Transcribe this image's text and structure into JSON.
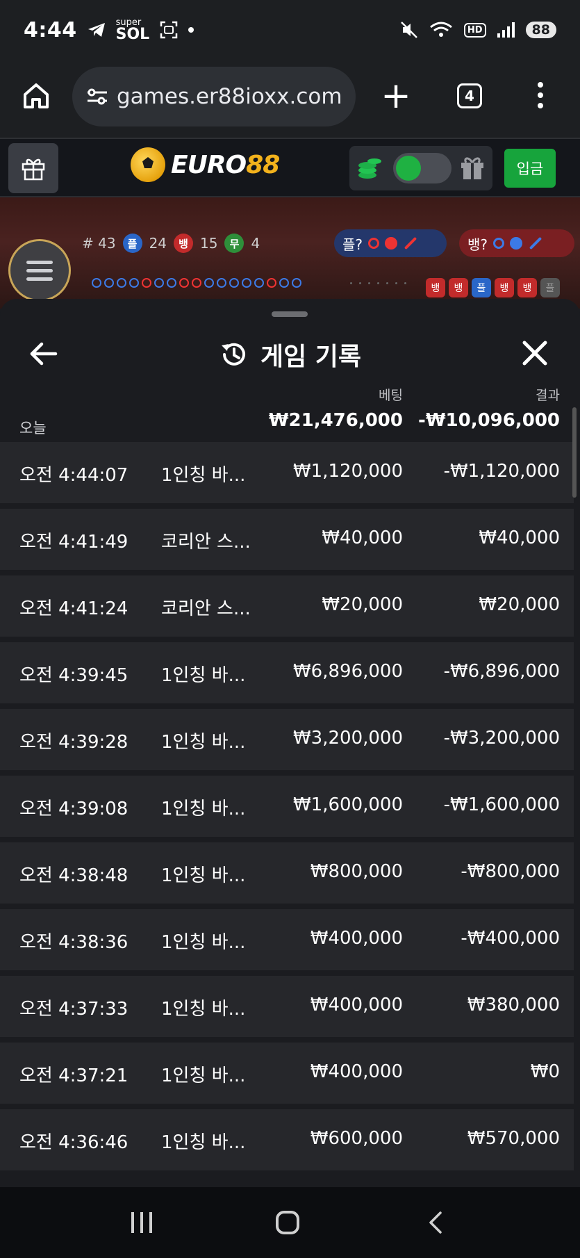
{
  "status_bar": {
    "time": "4:44",
    "super_line1": "super",
    "super_line2": "SOL",
    "hd": "HD",
    "battery": "88"
  },
  "browser": {
    "url": "games.er88ioxx.com",
    "tab_count": "4"
  },
  "site": {
    "logo_text_a": "EURO",
    "logo_text_b": "88",
    "deposit_label": "입금",
    "toggle_on": true
  },
  "game": {
    "round": "# 43",
    "player_label": "플",
    "player_count": "24",
    "banker_label": "뱅",
    "banker_count": "15",
    "tie_label": "무",
    "tie_count": "4",
    "ask_player": "플?",
    "ask_banker": "뱅?",
    "history_tags": [
      "뱅",
      "뱅",
      "플",
      "뱅",
      "뱅",
      "플"
    ]
  },
  "sheet": {
    "title": "게임 기록",
    "col_bet": "베팅",
    "col_result": "결과",
    "today_label": "오늘",
    "total_bet": "₩21,476,000",
    "total_result": "-₩10,096,000",
    "rows": [
      {
        "time": "오전 4:44:07",
        "game": "1인칭 바...",
        "bet": "₩1,120,000",
        "result": "-₩1,120,000"
      },
      {
        "time": "오전 4:41:49",
        "game": "코리안 스...",
        "bet": "₩40,000",
        "result": "₩40,000"
      },
      {
        "time": "오전 4:41:24",
        "game": "코리안 스...",
        "bet": "₩20,000",
        "result": "₩20,000"
      },
      {
        "time": "오전 4:39:45",
        "game": "1인칭 바...",
        "bet": "₩6,896,000",
        "result": "-₩6,896,000"
      },
      {
        "time": "오전 4:39:28",
        "game": "1인칭 바...",
        "bet": "₩3,200,000",
        "result": "-₩3,200,000"
      },
      {
        "time": "오전 4:39:08",
        "game": "1인칭 바...",
        "bet": "₩1,600,000",
        "result": "-₩1,600,000"
      },
      {
        "time": "오전 4:38:48",
        "game": "1인칭 바...",
        "bet": "₩800,000",
        "result": "-₩800,000"
      },
      {
        "time": "오전 4:38:36",
        "game": "1인칭 바...",
        "bet": "₩400,000",
        "result": "-₩400,000"
      },
      {
        "time": "오전 4:37:33",
        "game": "1인칭 바...",
        "bet": "₩400,000",
        "result": "₩380,000"
      },
      {
        "time": "오전 4:37:21",
        "game": "1인칭 바...",
        "bet": "₩400,000",
        "result": "₩0"
      },
      {
        "time": "오전 4:36:46",
        "game": "1인칭 바...",
        "bet": "₩600,000",
        "result": "₩570,000"
      }
    ]
  },
  "colors": {
    "accent_green": "#17a43c",
    "logo_gold": "#f3b21c",
    "player_blue": "#2a66c8",
    "banker_red": "#c22b2b"
  }
}
